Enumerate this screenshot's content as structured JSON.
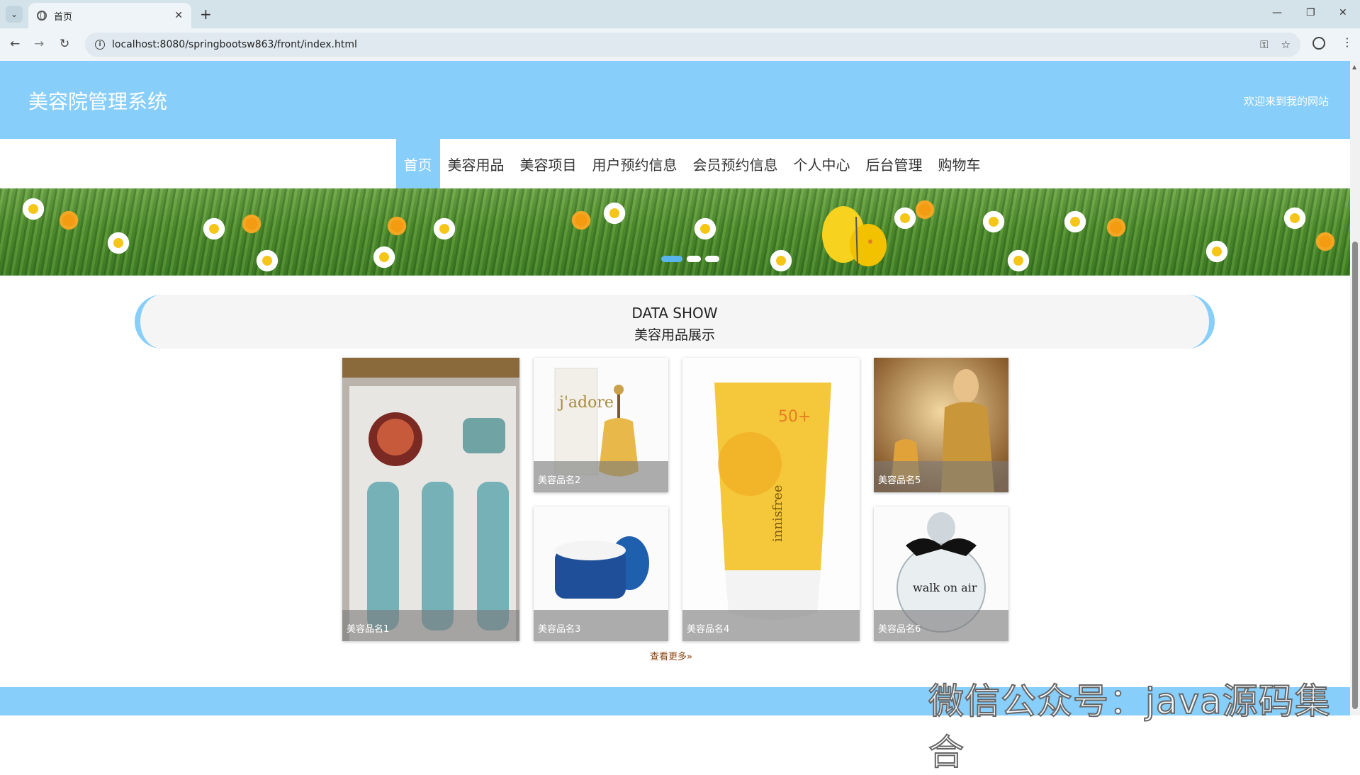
{
  "browser": {
    "tab_title": "首页",
    "url": "localhost:8080/springbootsw863/front/index.html",
    "new_tab": "+",
    "tab_close": "✕",
    "minimize": "—",
    "restore": "❐",
    "close": "✕",
    "back": "←",
    "forward": "→",
    "reload": "↻",
    "password_icon": "key-icon",
    "bookmark": "☆",
    "menu": "⋮"
  },
  "header": {
    "site_title": "美容院管理系统",
    "welcome": "欢迎来到我的网站"
  },
  "nav": {
    "items": [
      {
        "label": "首页",
        "active": true
      },
      {
        "label": "美容用品"
      },
      {
        "label": "美容项目"
      },
      {
        "label": "用户预约信息"
      },
      {
        "label": "会员预约信息"
      },
      {
        "label": "个人中心"
      },
      {
        "label": "后台管理"
      },
      {
        "label": "购物车"
      }
    ]
  },
  "banner": {
    "slides": 3,
    "active_slide": 1
  },
  "section": {
    "title_en": "DATA SHOW",
    "title_cn": "美容用品展示"
  },
  "products": [
    {
      "name": "美容品名1"
    },
    {
      "name": "美容品名2"
    },
    {
      "name": "美容品名3"
    },
    {
      "name": "美容品名4"
    },
    {
      "name": "美容品名5"
    },
    {
      "name": "美容品名6"
    }
  ],
  "more_label": "查看更多»",
  "watermark": "微信公众号：java源码集合",
  "colors": {
    "header_bg": "#87cefa",
    "nav_active": "#87cefa",
    "more_link": "#8b4513"
  }
}
